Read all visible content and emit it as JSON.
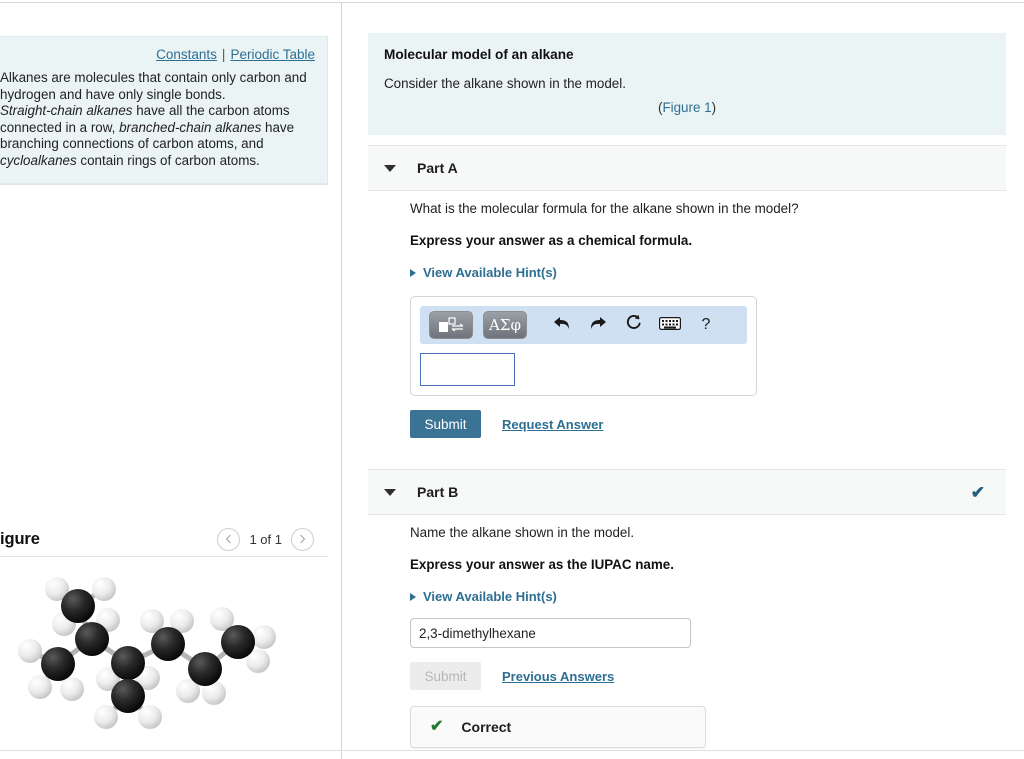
{
  "sidebar": {
    "links": {
      "constants": "Constants",
      "separator": "|",
      "periodic_table": "Periodic Table"
    },
    "info_paragraph_line1": "Alkanes are molecules that contain only carbon and hydrogen and have only single bonds.",
    "info_segments": {
      "s1": "Alkanes are molecules that contain only carbon and hydrogen and have only single bonds.",
      "s2_italic": "Straight-chain alkanes",
      "s3": " have all the carbon atoms connected in a row, ",
      "s4_italic": "branched-chain alkanes",
      "s5": " have branching connections of carbon atoms, and ",
      "s6_italic": "cycloalkanes",
      "s7": " contain rings of carbon atoms."
    },
    "figure": {
      "title": "Figure",
      "prev_icon": "chevron-left-icon",
      "next_icon": "chevron-right-icon",
      "counter": "1 of 1",
      "model_alt": "ball-and-stick model of 2,3-dimethylhexane"
    }
  },
  "intro": {
    "title": "Molecular model of an alkane",
    "text": "Consider the alkane shown in the model.",
    "figure_link_open": "(",
    "figure_link": "Figure 1",
    "figure_link_close": ")"
  },
  "parts": [
    {
      "id": "part-a",
      "label": "Part A",
      "caret_icon": "caret-down-icon",
      "status_icon": "",
      "question": "What is the molecular formula for the alkane shown in the model?",
      "instruction": "Express your answer as a chemical formula.",
      "hints_label": "View Available Hint(s)",
      "answer_widget": {
        "template_button": "template-icon",
        "greek_button": "ΑΣφ",
        "undo_icon": "↶",
        "redo_icon": "↷",
        "reset_icon": "⟳",
        "keyboard_icon": "keyboard-icon",
        "help_icon": "?",
        "input_value": ""
      },
      "submit_label": "Submit",
      "submit_disabled": false,
      "secondary_link": "Request Answer",
      "result": null
    },
    {
      "id": "part-b",
      "label": "Part B",
      "caret_icon": "caret-down-icon",
      "status_icon": "✔",
      "question": "Name the alkane shown in the model.",
      "instruction": "Express your answer as the IUPAC name.",
      "hints_label": "View Available Hint(s)",
      "answer_value": "2,3-dimethylhexane",
      "submit_label": "Submit",
      "submit_disabled": true,
      "secondary_link": "Previous Answers",
      "result": {
        "icon": "✔",
        "text": "Correct"
      }
    }
  ],
  "colors": {
    "info_panel_bg": "#eaf4f5",
    "link_blue": "#2e6e92",
    "submit_blue": "#3b7394",
    "toolbar_blue": "#cfe0f3",
    "correct_green": "#1f7a33",
    "part_check_teal": "#21607f",
    "part_header_bg": "#f7f8f8"
  }
}
